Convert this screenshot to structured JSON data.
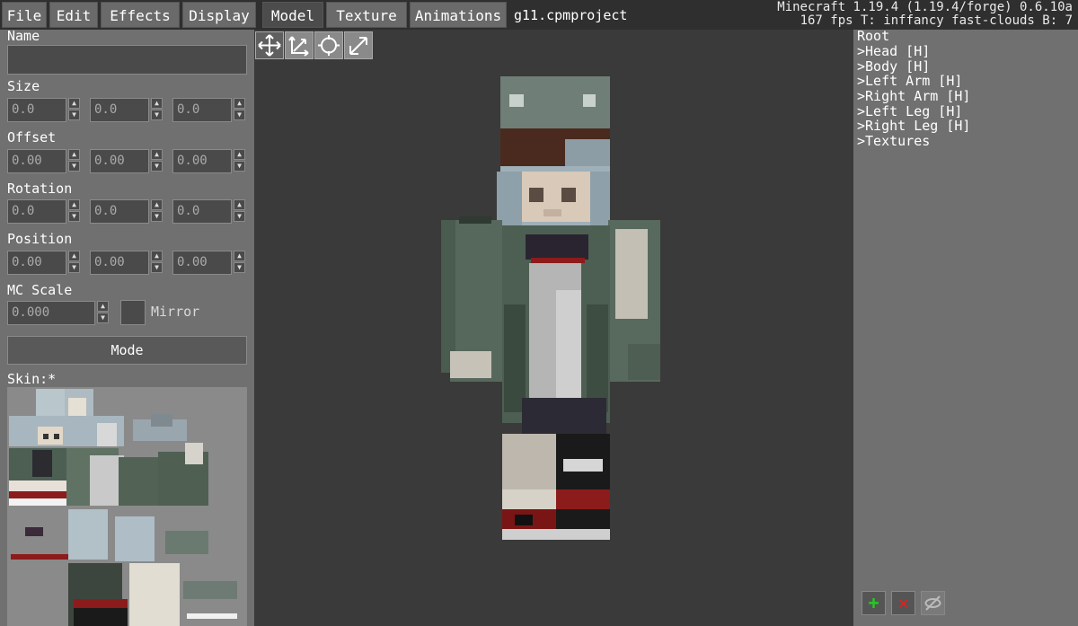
{
  "menu": {
    "file": "File",
    "edit": "Edit",
    "effects": "Effects",
    "display": "Display",
    "model": "Model",
    "texture": "Texture",
    "animations": "Animations"
  },
  "project_name": "g11.cpmproject",
  "mc_info": {
    "line1": "Minecraft 1.19.4 (1.19.4/forge) 0.6.10a",
    "line2": "167 fps T: inffancy fast-clouds B: 7"
  },
  "left": {
    "name_label": "Name",
    "name_value": "",
    "size_label": "Size",
    "size_values": [
      "0.0",
      "0.0",
      "0.0"
    ],
    "offset_label": "Offset",
    "offset_values": [
      "0.00",
      "0.00",
      "0.00"
    ],
    "rotation_label": "Rotation",
    "rotation_values": [
      "0.0",
      "0.0",
      "0.0"
    ],
    "position_label": "Position",
    "position_values": [
      "0.00",
      "0.00",
      "0.00"
    ],
    "mcscale_label": "MC Scale",
    "mcscale_value": "0.000",
    "mirror_label": "Mirror",
    "mode_label": "Mode",
    "skin_label": "Skin:*"
  },
  "tools": [
    "move-icon",
    "resize-icon",
    "rotate-icon",
    "scale-icon"
  ],
  "tree": {
    "root": "Root",
    "items": [
      "Head [H]",
      "Body [H]",
      "Left Arm [H]",
      "Right Arm [H]",
      "Left Leg [H]",
      "Right Leg [H]",
      "Textures"
    ]
  },
  "colors": {
    "add": "#22cc22",
    "delete": "#dd2222",
    "panel": "#707070"
  }
}
